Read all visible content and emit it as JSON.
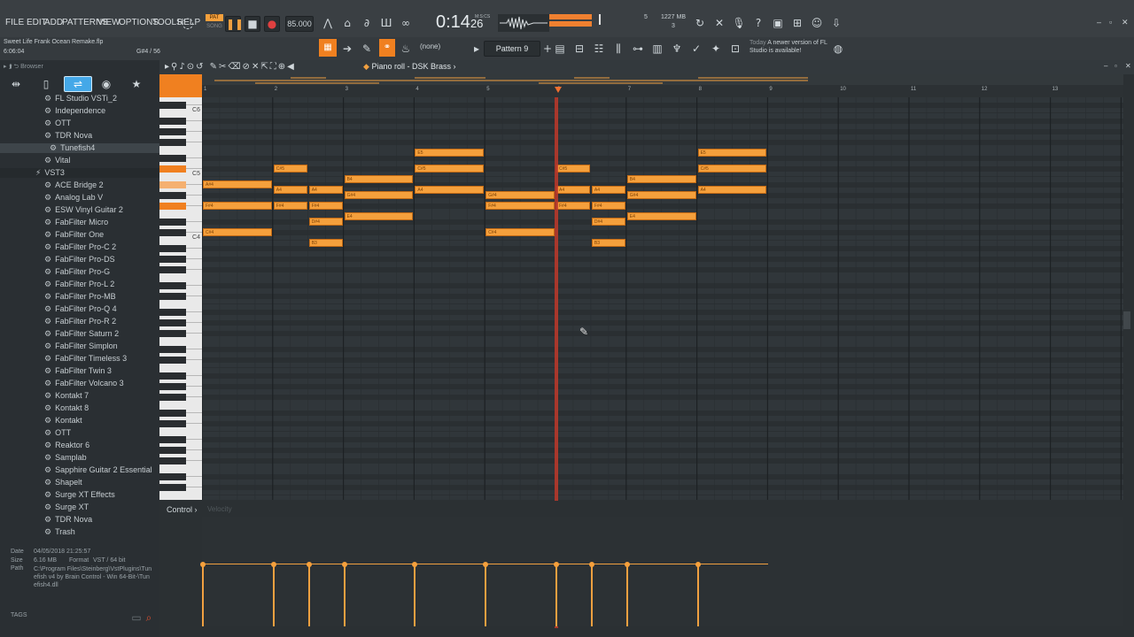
{
  "menu": [
    "FILE",
    "EDIT",
    "ADD",
    "PATTERNS",
    "VIEW",
    "OPTIONS",
    "TOOLS",
    "HELP"
  ],
  "project": {
    "file": "Sweet Life Frank Ocean Remake.flp",
    "time": "6:06:04"
  },
  "transport": {
    "mode_pat": "PAT",
    "mode_song": "SONG",
    "tempo": "85.000",
    "time": "0:14",
    "time_small": "26",
    "time_unit": "M:S:CS",
    "cpu": "5",
    "ram": "1227 MB",
    "ram2": "3"
  },
  "hint": {
    "note": "G#4 / 56"
  },
  "toolbar": {
    "snap": "(none)",
    "pattern": "Pattern 9",
    "news_date": "Today",
    "news_text": "A newer version of FL Studio is available!"
  },
  "browser": {
    "title": "Browser",
    "items": [
      {
        "label": "FL Studio VSTi_2",
        "type": "plugin"
      },
      {
        "label": "Independence",
        "type": "plugin"
      },
      {
        "label": "OTT",
        "type": "plugin"
      },
      {
        "label": "TDR Nova",
        "type": "plugin"
      },
      {
        "label": "Tunefish4",
        "type": "plugin",
        "selected": true
      },
      {
        "label": "Vital",
        "type": "plugin"
      },
      {
        "label": "VST3",
        "type": "folder"
      },
      {
        "label": "ACE Bridge 2",
        "type": "plugin"
      },
      {
        "label": "Analog Lab V",
        "type": "plugin"
      },
      {
        "label": "ESW Vinyl Guitar 2",
        "type": "plugin"
      },
      {
        "label": "FabFilter Micro",
        "type": "plugin"
      },
      {
        "label": "FabFilter One",
        "type": "plugin"
      },
      {
        "label": "FabFilter Pro-C 2",
        "type": "plugin"
      },
      {
        "label": "FabFilter Pro-DS",
        "type": "plugin"
      },
      {
        "label": "FabFilter Pro-G",
        "type": "plugin"
      },
      {
        "label": "FabFilter Pro-L 2",
        "type": "plugin"
      },
      {
        "label": "FabFilter Pro-MB",
        "type": "plugin"
      },
      {
        "label": "FabFilter Pro-Q 4",
        "type": "plugin"
      },
      {
        "label": "FabFilter Pro-R 2",
        "type": "plugin"
      },
      {
        "label": "FabFilter Saturn 2",
        "type": "plugin"
      },
      {
        "label": "FabFilter Simplon",
        "type": "plugin"
      },
      {
        "label": "FabFilter Timeless 3",
        "type": "plugin"
      },
      {
        "label": "FabFilter Twin 3",
        "type": "plugin"
      },
      {
        "label": "FabFilter Volcano 3",
        "type": "plugin"
      },
      {
        "label": "Kontakt 7",
        "type": "plugin"
      },
      {
        "label": "Kontakt 8",
        "type": "plugin"
      },
      {
        "label": "Kontakt",
        "type": "plugin"
      },
      {
        "label": "OTT",
        "type": "plugin"
      },
      {
        "label": "Reaktor 6",
        "type": "plugin"
      },
      {
        "label": "Samplab",
        "type": "plugin"
      },
      {
        "label": "Sapphire Guitar 2 Essential",
        "type": "plugin"
      },
      {
        "label": "Shapelt",
        "type": "plugin"
      },
      {
        "label": "Surge XT Effects",
        "type": "plugin"
      },
      {
        "label": "Surge XT",
        "type": "plugin"
      },
      {
        "label": "TDR Nova",
        "type": "plugin"
      },
      {
        "label": "Trash",
        "type": "plugin"
      }
    ]
  },
  "info": {
    "date_label": "Date",
    "date": "04/05/2018 21:25:57",
    "size_label": "Size",
    "size": "6.16 MB",
    "format_label": "Format",
    "format": "VST / 64 bit",
    "path_label": "Path",
    "path": "C:\\Program Files\\Steinberg\\VstPlugins\\Tunefish v4 by Brain Control - Win 64-Bit-\\Tunefish4.dll",
    "tags": "TAGS"
  },
  "pianoroll": {
    "title": "Piano roll - DSK Brass",
    "bars": [
      "1",
      "2",
      "3",
      "4",
      "5",
      "6",
      "7",
      "8",
      "9",
      "10",
      "11",
      "12",
      "13"
    ],
    "octave_labels": [
      "C6",
      "C5",
      "C4"
    ],
    "control_label": "Control",
    "control_target": "Velocity",
    "notes": [
      {
        "pitch": "A#4",
        "start": 1,
        "len": 1
      },
      {
        "pitch": "F#4",
        "start": 1,
        "len": 1
      },
      {
        "pitch": "C#4",
        "start": 1,
        "len": 1
      },
      {
        "pitch": "C#5",
        "start": 2,
        "len": 0.5
      },
      {
        "pitch": "A4",
        "start": 2,
        "len": 0.5
      },
      {
        "pitch": "F#4",
        "start": 2,
        "len": 0.5
      },
      {
        "pitch": "A4",
        "start": 2.5,
        "len": 0.5
      },
      {
        "pitch": "F#4",
        "start": 2.5,
        "len": 0.5
      },
      {
        "pitch": "D#4",
        "start": 2.5,
        "len": 0.5
      },
      {
        "pitch": "B3",
        "start": 2.5,
        "len": 0.5
      },
      {
        "pitch": "B4",
        "start": 3,
        "len": 1
      },
      {
        "pitch": "G#4",
        "start": 3,
        "len": 1
      },
      {
        "pitch": "E4",
        "start": 3,
        "len": 1
      },
      {
        "pitch": "E5",
        "start": 4,
        "len": 1
      },
      {
        "pitch": "C#5",
        "start": 4,
        "len": 1
      },
      {
        "pitch": "A4",
        "start": 4,
        "len": 1
      },
      {
        "pitch": "G#4",
        "start": 5,
        "len": 1
      },
      {
        "pitch": "F#4",
        "start": 5,
        "len": 1
      },
      {
        "pitch": "C#4",
        "start": 5,
        "len": 1
      },
      {
        "pitch": "C#5",
        "start": 6,
        "len": 0.5
      },
      {
        "pitch": "A4",
        "start": 6,
        "len": 0.5
      },
      {
        "pitch": "F#4",
        "start": 6,
        "len": 0.5
      },
      {
        "pitch": "A4",
        "start": 6.5,
        "len": 0.5
      },
      {
        "pitch": "F#4",
        "start": 6.5,
        "len": 0.5
      },
      {
        "pitch": "D#4",
        "start": 6.5,
        "len": 0.5
      },
      {
        "pitch": "B3",
        "start": 6.5,
        "len": 0.5
      },
      {
        "pitch": "B4",
        "start": 7,
        "len": 1
      },
      {
        "pitch": "G#4",
        "start": 7,
        "len": 1
      },
      {
        "pitch": "E4",
        "start": 7,
        "len": 1
      },
      {
        "pitch": "E5",
        "start": 8,
        "len": 1
      },
      {
        "pitch": "C#5",
        "start": 8,
        "len": 1
      },
      {
        "pitch": "A4",
        "start": 8,
        "len": 1
      }
    ],
    "playhead_bar": 6
  }
}
